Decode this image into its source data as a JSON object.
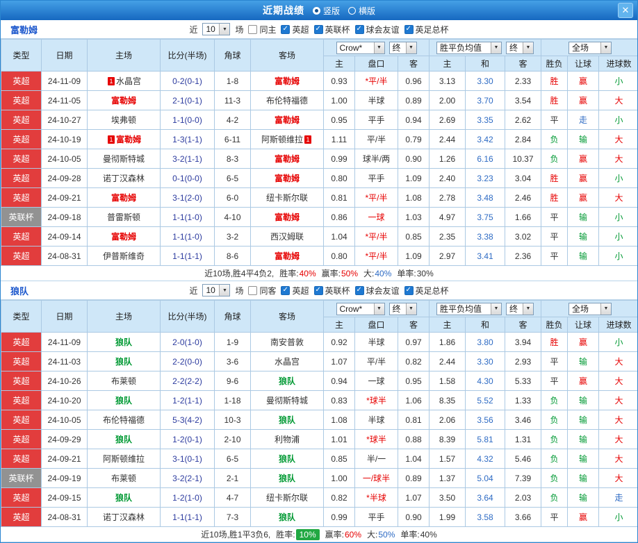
{
  "icons": {
    "close": "✕",
    "dropdown": "▼"
  },
  "colors": {
    "red": "#e60000",
    "green": "#009933",
    "blue": "#2e6bc4",
    "score_blue": "#2b3a9e",
    "league_bg": "#e23d3d",
    "cup_bg": "#929292",
    "header_bg": "#cfe7f8",
    "border": "#abc9e3",
    "accent_blue": "#1a56cc",
    "badge_green": "#21a842",
    "topbar_from": "#45a0e6",
    "topbar_to": "#1668c0"
  },
  "titlebar": {
    "title": "近期战绩",
    "vertical": "竖版",
    "horizontal": "横版"
  },
  "head": {
    "type": "类型",
    "date": "日期",
    "home": "主场",
    "score": "比分(半场)",
    "corner": "角球",
    "away": "客场",
    "odds_select": "Crow*",
    "final_select": "终",
    "avg_select": "胜平负均值",
    "avg_final_select": "终",
    "scope_select": "全场",
    "sub_cols": [
      "主",
      "盘口",
      "客",
      "主",
      "和",
      "客",
      "胜负",
      "让球",
      "进球数"
    ]
  },
  "filters": {
    "near": "近",
    "count": "10",
    "games": "场",
    "leagues": [
      "英超",
      "英联杯",
      "球会友谊",
      "英足总杯"
    ]
  },
  "sections": [
    {
      "team": "富勒姆",
      "same": "同主",
      "rows": [
        {
          "type": {
            "t": "英超",
            "k": "l"
          },
          "date": "24-11-09",
          "home": {
            "t": "水晶宫",
            "c": "k",
            "b": "1"
          },
          "score": "0-2(0-1)",
          "corner": "1-8",
          "away": {
            "t": "富勒姆",
            "c": "r"
          },
          "odds": [
            "0.93",
            {
              "t": "*平/半",
              "c": "r"
            },
            "0.96"
          ],
          "avg": [
            "3.13",
            "3.30",
            "2.33"
          ],
          "res": {
            "t": "胜",
            "c": "r"
          },
          "let": {
            "t": "赢",
            "c": "r"
          },
          "goal": {
            "t": "小",
            "c": "g"
          }
        },
        {
          "type": {
            "t": "英超",
            "k": "l"
          },
          "date": "24-11-05",
          "home": {
            "t": "富勒姆",
            "c": "r"
          },
          "score": "2-1(0-1)",
          "corner": "11-3",
          "away": {
            "t": "布伦特福德",
            "c": "k"
          },
          "odds": [
            "1.00",
            {
              "t": "半球",
              "c": "k"
            },
            "0.89"
          ],
          "avg": [
            "2.00",
            "3.70",
            "3.54"
          ],
          "res": {
            "t": "胜",
            "c": "r"
          },
          "let": {
            "t": "赢",
            "c": "r"
          },
          "goal": {
            "t": "大",
            "c": "r"
          }
        },
        {
          "type": {
            "t": "英超",
            "k": "l"
          },
          "date": "24-10-27",
          "home": {
            "t": "埃弗顿",
            "c": "k"
          },
          "score": "1-1(0-0)",
          "corner": "4-2",
          "away": {
            "t": "富勒姆",
            "c": "r"
          },
          "odds": [
            "0.95",
            {
              "t": "平手",
              "c": "k"
            },
            "0.94"
          ],
          "avg": [
            "2.69",
            "3.35",
            "2.62"
          ],
          "res": {
            "t": "平",
            "c": "k"
          },
          "let": {
            "t": "走",
            "c": "b"
          },
          "goal": {
            "t": "小",
            "c": "g"
          }
        },
        {
          "type": {
            "t": "英超",
            "k": "l"
          },
          "date": "24-10-19",
          "home": {
            "t": "富勒姆",
            "c": "r",
            "b": "1"
          },
          "score": "1-3(1-1)",
          "corner": "6-11",
          "away": {
            "t": "阿斯顿维拉",
            "c": "k",
            "b": "1"
          },
          "odds": [
            "1.11",
            {
              "t": "平/半",
              "c": "k"
            },
            "0.79"
          ],
          "avg": [
            "2.44",
            "3.42",
            "2.84"
          ],
          "res": {
            "t": "负",
            "c": "g"
          },
          "let": {
            "t": "输",
            "c": "g"
          },
          "goal": {
            "t": "大",
            "c": "r"
          }
        },
        {
          "type": {
            "t": "英超",
            "k": "l"
          },
          "date": "24-10-05",
          "home": {
            "t": "曼彻斯特城",
            "c": "k"
          },
          "score": "3-2(1-1)",
          "corner": "8-3",
          "away": {
            "t": "富勒姆",
            "c": "r"
          },
          "odds": [
            "0.99",
            {
              "t": "球半/两",
              "c": "k"
            },
            "0.90"
          ],
          "avg": [
            "1.26",
            "6.16",
            "10.37"
          ],
          "res": {
            "t": "负",
            "c": "g"
          },
          "let": {
            "t": "赢",
            "c": "r"
          },
          "goal": {
            "t": "大",
            "c": "r"
          }
        },
        {
          "type": {
            "t": "英超",
            "k": "l"
          },
          "date": "24-09-28",
          "home": {
            "t": "诺丁汉森林",
            "c": "k"
          },
          "score": "0-1(0-0)",
          "corner": "6-5",
          "away": {
            "t": "富勒姆",
            "c": "r"
          },
          "odds": [
            "0.80",
            {
              "t": "平手",
              "c": "k"
            },
            "1.09"
          ],
          "avg": [
            "2.40",
            "3.23",
            "3.04"
          ],
          "res": {
            "t": "胜",
            "c": "r"
          },
          "let": {
            "t": "赢",
            "c": "r"
          },
          "goal": {
            "t": "小",
            "c": "g"
          }
        },
        {
          "type": {
            "t": "英超",
            "k": "l"
          },
          "date": "24-09-21",
          "home": {
            "t": "富勒姆",
            "c": "r"
          },
          "score": "3-1(2-0)",
          "corner": "6-0",
          "away": {
            "t": "纽卡斯尔联",
            "c": "k"
          },
          "odds": [
            "0.81",
            {
              "t": "*平/半",
              "c": "r"
            },
            "1.08"
          ],
          "avg": [
            "2.78",
            "3.48",
            "2.46"
          ],
          "res": {
            "t": "胜",
            "c": "r"
          },
          "let": {
            "t": "赢",
            "c": "r"
          },
          "goal": {
            "t": "大",
            "c": "r"
          }
        },
        {
          "type": {
            "t": "英联杯",
            "k": "c"
          },
          "date": "24-09-18",
          "home": {
            "t": "普雷斯顿",
            "c": "k"
          },
          "score": "1-1(1-0)",
          "corner": "4-10",
          "away": {
            "t": "富勒姆",
            "c": "r"
          },
          "odds": [
            "0.86",
            {
              "t": "一球",
              "c": "r"
            },
            "1.03"
          ],
          "avg": [
            "4.97",
            "3.75",
            "1.66"
          ],
          "res": {
            "t": "平",
            "c": "k"
          },
          "let": {
            "t": "输",
            "c": "g"
          },
          "goal": {
            "t": "小",
            "c": "g"
          }
        },
        {
          "type": {
            "t": "英超",
            "k": "l"
          },
          "date": "24-09-14",
          "home": {
            "t": "富勒姆",
            "c": "r"
          },
          "score": "1-1(1-0)",
          "corner": "3-2",
          "away": {
            "t": "西汉姆联",
            "c": "k"
          },
          "odds": [
            "1.04",
            {
              "t": "*平/半",
              "c": "r"
            },
            "0.85"
          ],
          "avg": [
            "2.35",
            "3.38",
            "3.02"
          ],
          "res": {
            "t": "平",
            "c": "k"
          },
          "let": {
            "t": "输",
            "c": "g"
          },
          "goal": {
            "t": "小",
            "c": "g"
          }
        },
        {
          "type": {
            "t": "英超",
            "k": "l"
          },
          "date": "24-08-31",
          "home": {
            "t": "伊普斯维奇",
            "c": "k"
          },
          "score": "1-1(1-1)",
          "corner": "8-6",
          "away": {
            "t": "富勒姆",
            "c": "r"
          },
          "odds": [
            "0.80",
            {
              "t": "*平/半",
              "c": "r"
            },
            "1.09"
          ],
          "avg": [
            "2.97",
            "3.41",
            "2.36"
          ],
          "res": {
            "t": "平",
            "c": "k"
          },
          "let": {
            "t": "输",
            "c": "g"
          },
          "goal": {
            "t": "小",
            "c": "g"
          }
        }
      ],
      "footer": {
        "summary": "近10场,胜4平4负2,",
        "stats": [
          {
            "label": "胜率:",
            "value": "40%",
            "c": "r"
          },
          {
            "label": "赢率:",
            "value": "50%",
            "c": "r"
          },
          {
            "label": "大:",
            "value": "40%",
            "c": "b"
          },
          {
            "label": "单率:",
            "value": "30%",
            "c": "k"
          }
        ]
      }
    },
    {
      "team": "狼队",
      "same": "同客",
      "rows": [
        {
          "type": {
            "t": "英超",
            "k": "l"
          },
          "date": "24-11-09",
          "home": {
            "t": "狼队",
            "c": "g"
          },
          "score": "2-0(1-0)",
          "corner": "1-9",
          "away": {
            "t": "南安普敦",
            "c": "k"
          },
          "odds": [
            "0.92",
            {
              "t": "半球",
              "c": "k"
            },
            "0.97"
          ],
          "avg": [
            "1.86",
            "3.80",
            "3.94"
          ],
          "res": {
            "t": "胜",
            "c": "r"
          },
          "let": {
            "t": "赢",
            "c": "r"
          },
          "goal": {
            "t": "小",
            "c": "g"
          }
        },
        {
          "type": {
            "t": "英超",
            "k": "l"
          },
          "date": "24-11-03",
          "home": {
            "t": "狼队",
            "c": "g"
          },
          "score": "2-2(0-0)",
          "corner": "3-6",
          "away": {
            "t": "水晶宫",
            "c": "k"
          },
          "odds": [
            "1.07",
            {
              "t": "平/半",
              "c": "k"
            },
            "0.82"
          ],
          "avg": [
            "2.44",
            "3.30",
            "2.93"
          ],
          "res": {
            "t": "平",
            "c": "k"
          },
          "let": {
            "t": "输",
            "c": "g"
          },
          "goal": {
            "t": "大",
            "c": "r"
          }
        },
        {
          "type": {
            "t": "英超",
            "k": "l"
          },
          "date": "24-10-26",
          "home": {
            "t": "布莱顿",
            "c": "k"
          },
          "score": "2-2(2-2)",
          "corner": "9-6",
          "away": {
            "t": "狼队",
            "c": "g"
          },
          "odds": [
            "0.94",
            {
              "t": "一球",
              "c": "k"
            },
            "0.95"
          ],
          "avg": [
            "1.58",
            "4.30",
            "5.33"
          ],
          "res": {
            "t": "平",
            "c": "k"
          },
          "let": {
            "t": "赢",
            "c": "r"
          },
          "goal": {
            "t": "大",
            "c": "r"
          }
        },
        {
          "type": {
            "t": "英超",
            "k": "l"
          },
          "date": "24-10-20",
          "home": {
            "t": "狼队",
            "c": "g"
          },
          "score": "1-2(1-1)",
          "corner": "1-18",
          "away": {
            "t": "曼彻斯特城",
            "c": "k"
          },
          "odds": [
            "0.83",
            {
              "t": "*球半",
              "c": "r"
            },
            "1.06"
          ],
          "avg": [
            "8.35",
            "5.52",
            "1.33"
          ],
          "res": {
            "t": "负",
            "c": "g"
          },
          "let": {
            "t": "输",
            "c": "g"
          },
          "goal": {
            "t": "大",
            "c": "r"
          }
        },
        {
          "type": {
            "t": "英超",
            "k": "l"
          },
          "date": "24-10-05",
          "home": {
            "t": "布伦特福德",
            "c": "k"
          },
          "score": "5-3(4-2)",
          "corner": "10-3",
          "away": {
            "t": "狼队",
            "c": "g"
          },
          "odds": [
            "1.08",
            {
              "t": "半球",
              "c": "k"
            },
            "0.81"
          ],
          "avg": [
            "2.06",
            "3.56",
            "3.46"
          ],
          "res": {
            "t": "负",
            "c": "g"
          },
          "let": {
            "t": "输",
            "c": "g"
          },
          "goal": {
            "t": "大",
            "c": "r"
          }
        },
        {
          "type": {
            "t": "英超",
            "k": "l"
          },
          "date": "24-09-29",
          "home": {
            "t": "狼队",
            "c": "g"
          },
          "score": "1-2(0-1)",
          "corner": "2-10",
          "away": {
            "t": "利物浦",
            "c": "k"
          },
          "odds": [
            "1.01",
            {
              "t": "*球半",
              "c": "r"
            },
            "0.88"
          ],
          "avg": [
            "8.39",
            "5.81",
            "1.31"
          ],
          "res": {
            "t": "负",
            "c": "g"
          },
          "let": {
            "t": "输",
            "c": "g"
          },
          "goal": {
            "t": "大",
            "c": "r"
          }
        },
        {
          "type": {
            "t": "英超",
            "k": "l"
          },
          "date": "24-09-21",
          "home": {
            "t": "阿斯顿维拉",
            "c": "k"
          },
          "score": "3-1(0-1)",
          "corner": "6-5",
          "away": {
            "t": "狼队",
            "c": "g"
          },
          "odds": [
            "0.85",
            {
              "t": "半/一",
              "c": "k"
            },
            "1.04"
          ],
          "avg": [
            "1.57",
            "4.32",
            "5.46"
          ],
          "res": {
            "t": "负",
            "c": "g"
          },
          "let": {
            "t": "输",
            "c": "g"
          },
          "goal": {
            "t": "大",
            "c": "r"
          }
        },
        {
          "type": {
            "t": "英联杯",
            "k": "c"
          },
          "date": "24-09-19",
          "home": {
            "t": "布莱顿",
            "c": "k"
          },
          "score": "3-2(2-1)",
          "corner": "2-1",
          "away": {
            "t": "狼队",
            "c": "g"
          },
          "odds": [
            "1.00",
            {
              "t": "一/球半",
              "c": "r"
            },
            "0.89"
          ],
          "avg": [
            "1.37",
            "5.04",
            "7.39"
          ],
          "res": {
            "t": "负",
            "c": "g"
          },
          "let": {
            "t": "输",
            "c": "g"
          },
          "goal": {
            "t": "大",
            "c": "r"
          }
        },
        {
          "type": {
            "t": "英超",
            "k": "l"
          },
          "date": "24-09-15",
          "home": {
            "t": "狼队",
            "c": "g"
          },
          "score": "1-2(1-0)",
          "corner": "4-7",
          "away": {
            "t": "纽卡斯尔联",
            "c": "k"
          },
          "odds": [
            "0.82",
            {
              "t": "*半球",
              "c": "r"
            },
            "1.07"
          ],
          "avg": [
            "3.50",
            "3.64",
            "2.03"
          ],
          "res": {
            "t": "负",
            "c": "g"
          },
          "let": {
            "t": "输",
            "c": "g"
          },
          "goal": {
            "t": "走",
            "c": "b"
          }
        },
        {
          "type": {
            "t": "英超",
            "k": "l"
          },
          "date": "24-08-31",
          "home": {
            "t": "诺丁汉森林",
            "c": "k"
          },
          "score": "1-1(1-1)",
          "corner": "7-3",
          "away": {
            "t": "狼队",
            "c": "g"
          },
          "odds": [
            "0.99",
            {
              "t": "平手",
              "c": "k"
            },
            "0.90"
          ],
          "avg": [
            "1.99",
            "3.58",
            "3.66"
          ],
          "res": {
            "t": "平",
            "c": "k"
          },
          "let": {
            "t": "赢",
            "c": "r"
          },
          "goal": {
            "t": "小",
            "c": "g"
          }
        }
      ],
      "footer": {
        "summary": "近10场,胜1平3负6,",
        "stats": [
          {
            "label": "胜率:",
            "value": "10%",
            "badge": true
          },
          {
            "label": "赢率:",
            "value": "60%",
            "c": "r"
          },
          {
            "label": "大:",
            "value": "50%",
            "c": "b"
          },
          {
            "label": "单率:",
            "value": "40%",
            "c": "k"
          }
        ]
      }
    }
  ]
}
